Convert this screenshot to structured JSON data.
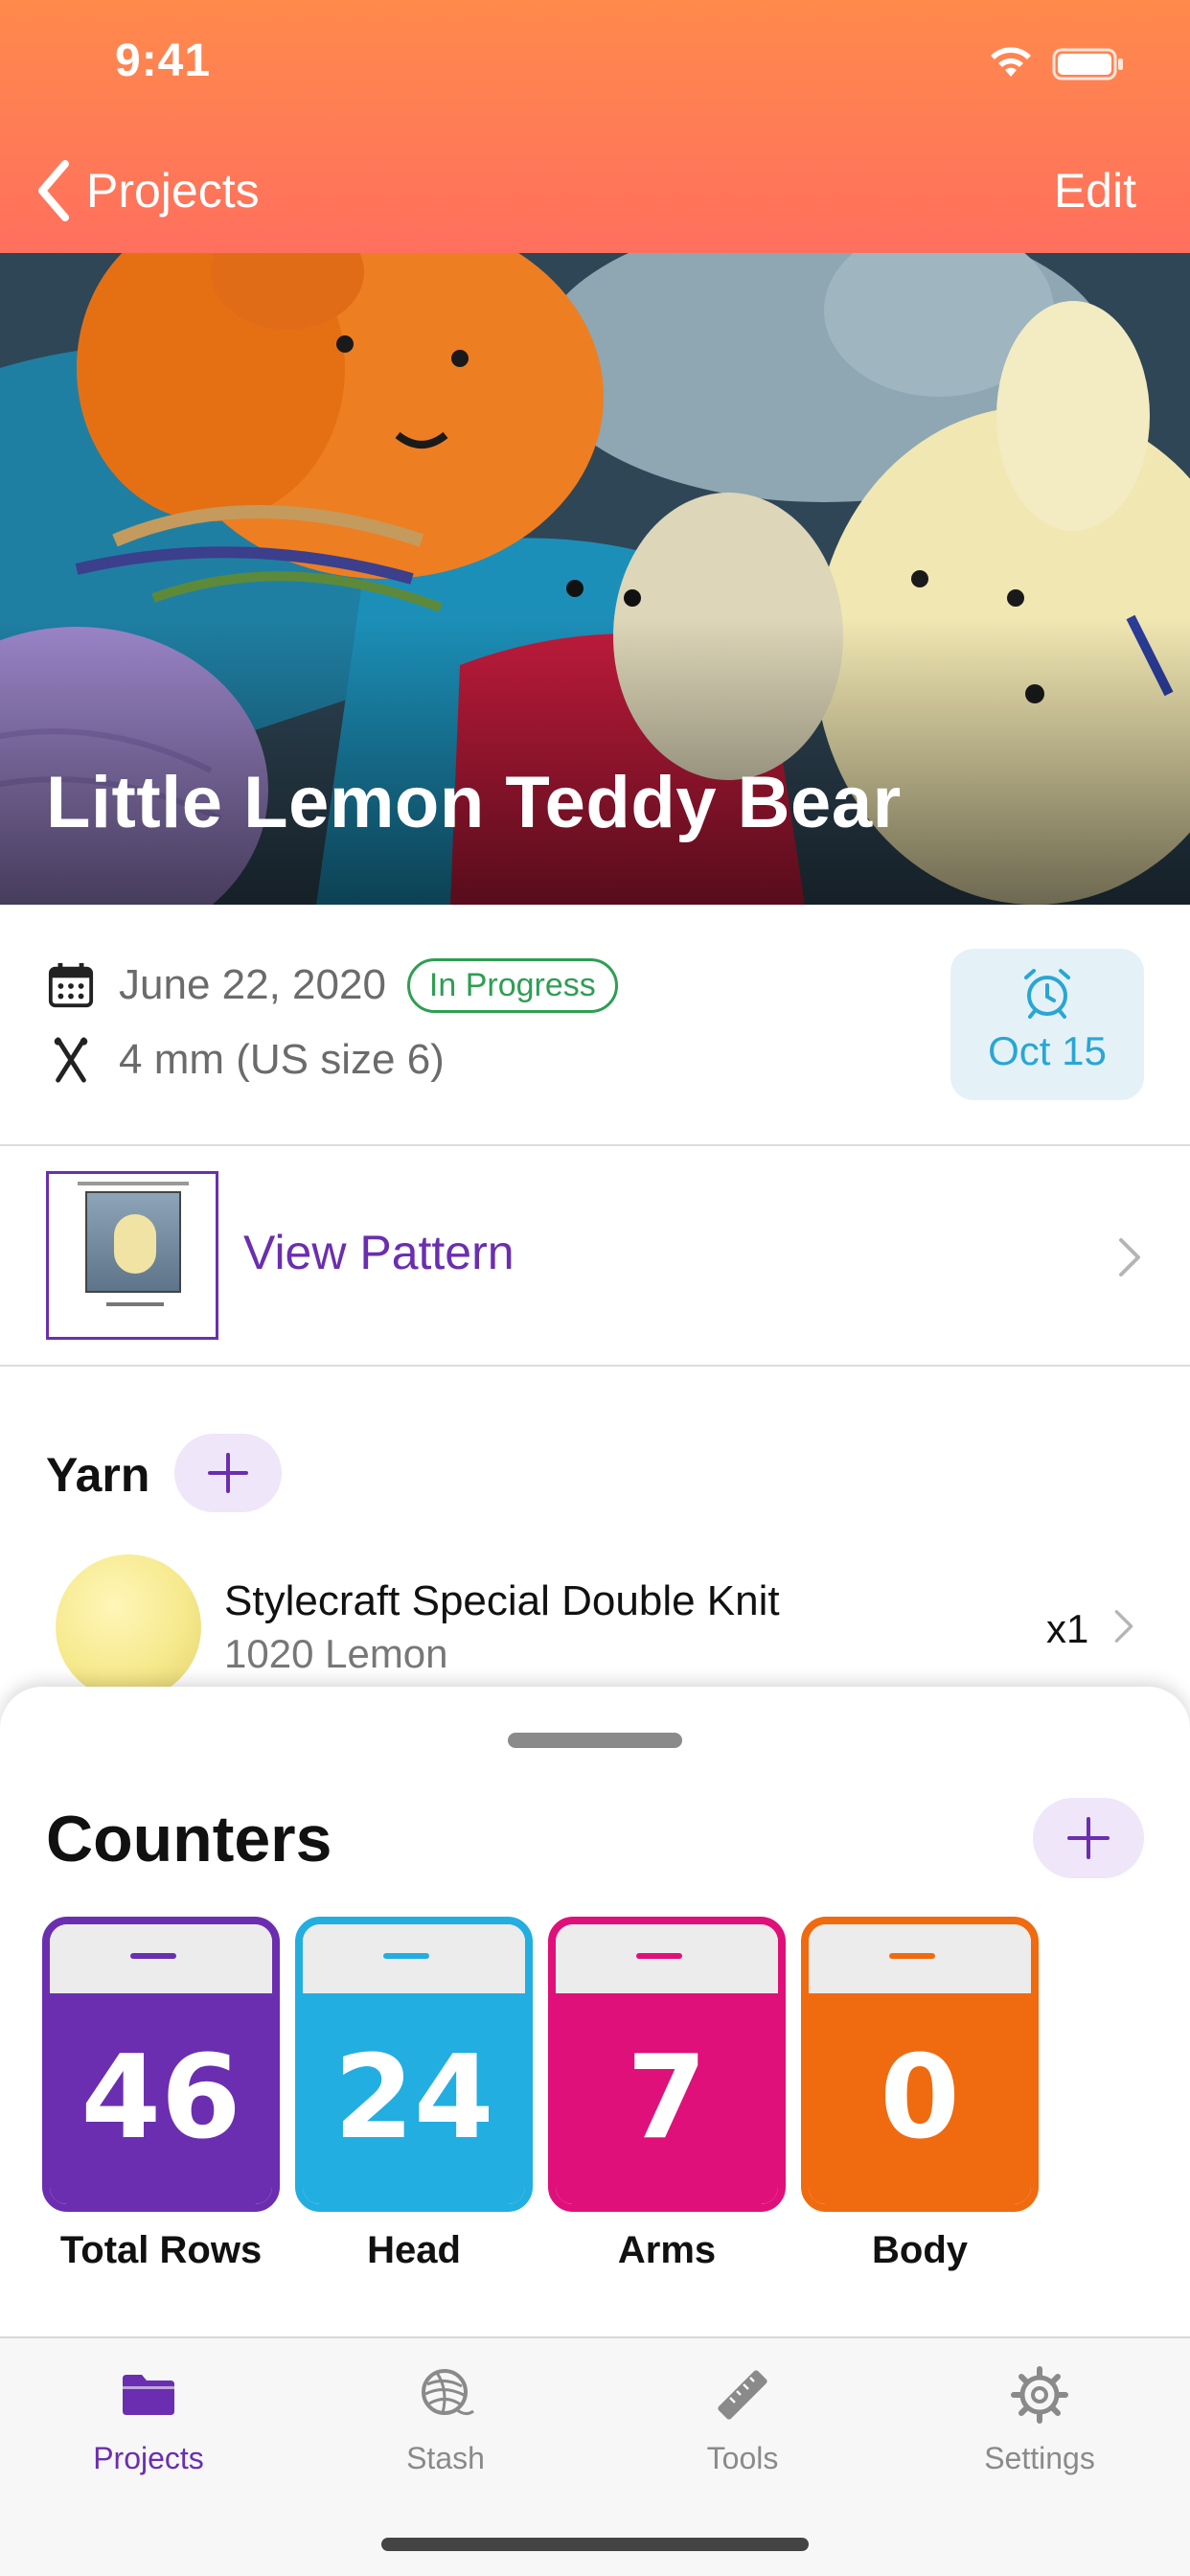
{
  "status_bar": {
    "time": "9:41",
    "wifi_icon": "wifi-icon",
    "battery_icon": "battery-icon"
  },
  "nav": {
    "back_label": "Projects",
    "edit_label": "Edit",
    "gradient_top": "#ff8a4c",
    "gradient_bottom": "#ff6f5e"
  },
  "hero": {
    "title": "Little Lemon Teddy Bear"
  },
  "project_info": {
    "date": "June 22, 2020",
    "status": "In Progress",
    "status_color": "#2e9e53",
    "needle_size": "4 mm (US size 6)",
    "reminder_date": "Oct 15",
    "reminder_color": "#29a6d4"
  },
  "pattern": {
    "label": "View Pattern",
    "accent": "#6b2eb0"
  },
  "yarn": {
    "heading": "Yarn",
    "items": [
      {
        "name": "Stylecraft Special Double Knit",
        "color_name": "1020 Lemon",
        "quantity": "x1"
      }
    ]
  },
  "counters": {
    "title": "Counters",
    "items": [
      {
        "label": "Total Rows",
        "value": "46",
        "color": "#6b2eb0"
      },
      {
        "label": "Head",
        "value": "24",
        "color": "#22aee0"
      },
      {
        "label": "Arms",
        "value": "7",
        "color": "#e0107a"
      },
      {
        "label": "Body",
        "value": "0",
        "color": "#f06a10"
      }
    ]
  },
  "tabs": [
    {
      "label": "Projects",
      "icon": "folder-icon",
      "active": true
    },
    {
      "label": "Stash",
      "icon": "yarn-ball-icon",
      "active": false
    },
    {
      "label": "Tools",
      "icon": "ruler-icon",
      "active": false
    },
    {
      "label": "Settings",
      "icon": "gear-icon",
      "active": false
    }
  ]
}
